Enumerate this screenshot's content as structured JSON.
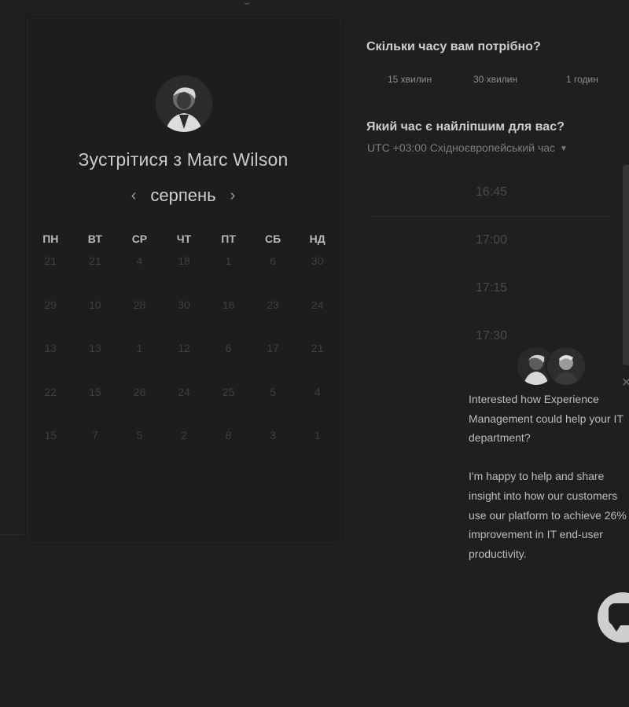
{
  "scheduler": {
    "title": "Зустрітися з Marc Wilson",
    "month": "серпень",
    "prev_icon": "chevron-left-icon",
    "next_icon": "chevron-right-icon",
    "weekdays": [
      "ПН",
      "ВТ",
      "СР",
      "ЧТ",
      "ПТ",
      "СБ",
      "НД"
    ],
    "weeks": [
      [
        "21",
        "21",
        "4",
        "18",
        "1",
        "6",
        "30"
      ],
      [
        "29",
        "10",
        "28",
        "30",
        "16",
        "23",
        "24"
      ],
      [
        "13",
        "13",
        "1",
        "12",
        "6",
        "17",
        "21"
      ],
      [
        "22",
        "15",
        "26",
        "24",
        "25",
        "5",
        "4"
      ],
      [
        "15",
        "7",
        "5",
        "2",
        "8",
        "3",
        "1"
      ]
    ]
  },
  "duration": {
    "question": "Скільки часу вам потрібно?",
    "options": [
      "15 хвилин",
      "30 хвилин",
      "1 годин"
    ]
  },
  "time": {
    "question": "Який час є найліпшим для вас?",
    "timezone": "UTC +03:00 Східноєвропейський час",
    "slots": [
      "16:45",
      "17:00",
      "17:15",
      "17:30"
    ]
  },
  "chat": {
    "message_1": "Interested how Experience Management could help your IT department?",
    "message_2": "I'm happy to help and share insight into how our customers use our platform to achieve 26% improvement in IT end-user productivity.",
    "close_icon": "close-icon",
    "launcher_icon": "chat-bubble-icon"
  },
  "colors": {
    "background": "#1f1f1f",
    "card": "#1d1d1d",
    "launcher": "#cfcfcf"
  }
}
